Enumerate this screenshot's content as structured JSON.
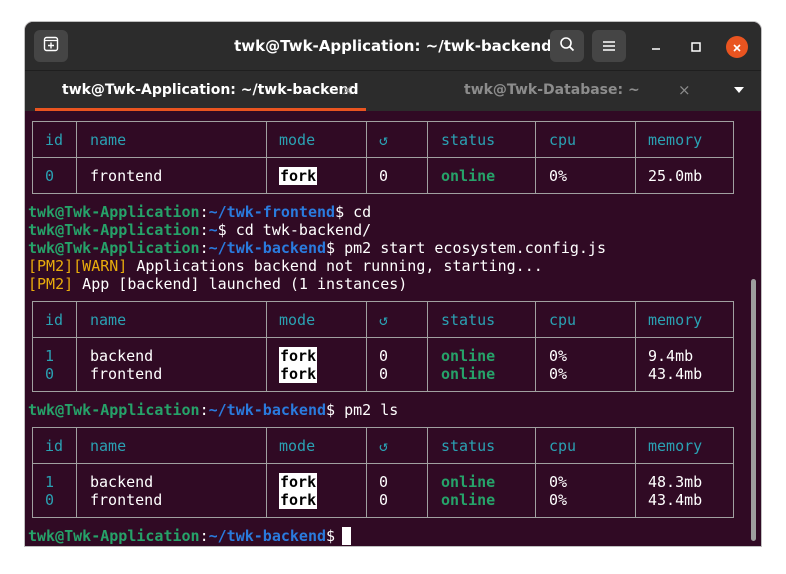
{
  "window": {
    "title": "twk@Twk-Application: ~/twk-backend"
  },
  "tabs": [
    {
      "label": "twk@Twk-Application: ~/twk-backend",
      "active": true
    },
    {
      "label": "twk@Twk-Database: ~",
      "active": false
    }
  ],
  "icons": {
    "new_tab": "new-tab-icon",
    "search": "search-icon",
    "menu": "hamburger-menu-icon",
    "minimize": "minimize-icon",
    "maximize": "maximize-icon",
    "close": "close-icon",
    "tab_close": "×",
    "restart": "↺"
  },
  "colors": {
    "terminal_bg": "#300a24",
    "prompt_user": "#26a269",
    "prompt_path": "#2a7bde",
    "table_header": "#2aa1b3",
    "online": "#26a269",
    "warn": "#e9ad0c",
    "active_tab_underline": "#e95420",
    "close_button": "#e95420"
  },
  "prompt": {
    "user": "twk@Twk-Application",
    "sep": ":",
    "dollar": "$"
  },
  "table_headers": [
    "id",
    "name",
    "mode",
    "↺",
    "status",
    "cpu",
    "memory"
  ],
  "table1": {
    "rows": [
      {
        "id": "0",
        "name": "frontend",
        "mode": "fork",
        "restarts": "0",
        "status": "online",
        "cpu": "0%",
        "memory": "25.0mb"
      }
    ]
  },
  "commands": [
    {
      "path": "~/twk-frontend",
      "cmd": " cd"
    },
    {
      "path": "~",
      "cmd": " cd twk-backend/"
    },
    {
      "path": "~/twk-backend",
      "cmd": " pm2 start ecosystem.config.js"
    }
  ],
  "messages": {
    "warn_prefix": "[PM2][WARN]",
    "warn_text": " Applications backend not running, starting...",
    "info_prefix": "[PM2]",
    "info_text": " App [backend] launched (1 instances)"
  },
  "table2": {
    "rows": [
      {
        "id": "1",
        "name": "backend",
        "mode": "fork",
        "restarts": "0",
        "status": "online",
        "cpu": "0%",
        "memory": "9.4mb"
      },
      {
        "id": "0",
        "name": "frontend",
        "mode": "fork",
        "restarts": "0",
        "status": "online",
        "cpu": "0%",
        "memory": "43.4mb"
      }
    ]
  },
  "command_ls": {
    "path": "~/twk-backend",
    "cmd": " pm2 ls"
  },
  "table3": {
    "rows": [
      {
        "id": "1",
        "name": "backend",
        "mode": "fork",
        "restarts": "0",
        "status": "online",
        "cpu": "0%",
        "memory": "48.3mb"
      },
      {
        "id": "0",
        "name": "frontend",
        "mode": "fork",
        "restarts": "0",
        "status": "online",
        "cpu": "0%",
        "memory": "43.4mb"
      }
    ]
  },
  "final_prompt": {
    "path": "~/twk-backend",
    "cmd": " "
  }
}
